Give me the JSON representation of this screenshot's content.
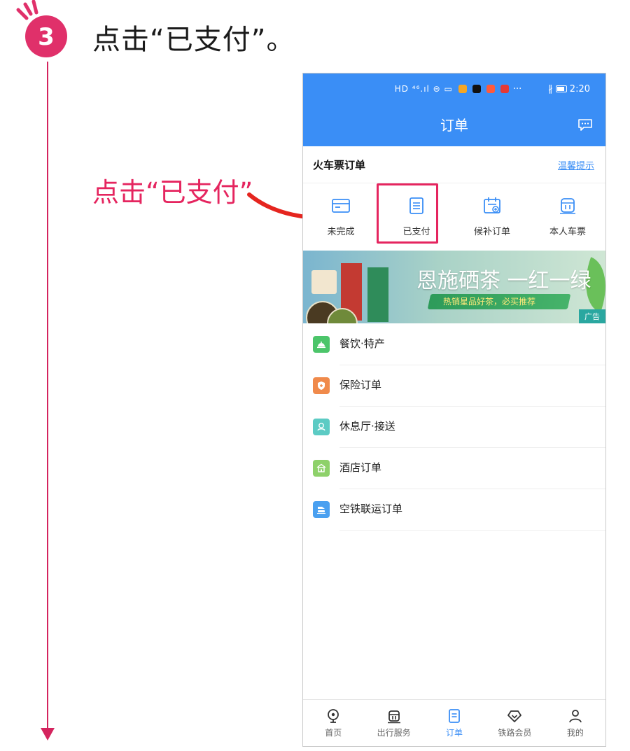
{
  "tutorial": {
    "step_number": "3",
    "title": "点击“已支付”。",
    "callout": "点击“已支付”",
    "accent_color": "#e5255f",
    "badge_color": "#e0306a"
  },
  "status_bar": {
    "left_icons": "HD ⁴⁶.ıl ⊜ ▭",
    "more": "···",
    "right_icons": "∦",
    "time": "2:20"
  },
  "nav": {
    "title": "订单",
    "right_icon": "message-icon"
  },
  "ticket_section": {
    "title": "火车票订单",
    "tip_link": "温馨提示",
    "tabs": [
      {
        "label": "未完成",
        "icon": "ticket-card-icon"
      },
      {
        "label": "已支付",
        "icon": "paid-list-icon"
      },
      {
        "label": "候补订单",
        "icon": "waitlist-calendar-icon"
      },
      {
        "label": "本人车票",
        "icon": "train-icon"
      }
    ]
  },
  "banner": {
    "headline": "恩施硒茶 一红一绿",
    "subline": "热销星品好茶，必买推荐",
    "ad_tag": "广告"
  },
  "services": [
    {
      "label": "餐饮·特产",
      "icon": "food-bell-icon",
      "color": "#4cc56a"
    },
    {
      "label": "保险订单",
      "icon": "insurance-shield-icon",
      "color": "#f08a4b"
    },
    {
      "label": "休息厅·接送",
      "icon": "lounge-icon",
      "color": "#5ccbc4"
    },
    {
      "label": "酒店订单",
      "icon": "hotel-icon",
      "color": "#8ed16a"
    },
    {
      "label": "空铁联运订单",
      "icon": "air-rail-icon",
      "color": "#4aa0f0"
    }
  ],
  "tabbar": [
    {
      "label": "首页",
      "icon": "home-icon",
      "active": false
    },
    {
      "label": "出行服务",
      "icon": "travel-service-icon",
      "active": false
    },
    {
      "label": "订单",
      "icon": "order-icon",
      "active": true
    },
    {
      "label": "铁路会员",
      "icon": "member-icon",
      "active": false
    },
    {
      "label": "我的",
      "icon": "profile-icon",
      "active": false
    }
  ],
  "colors": {
    "primary": "#3a8ef6",
    "timeline": "#d4245e"
  }
}
